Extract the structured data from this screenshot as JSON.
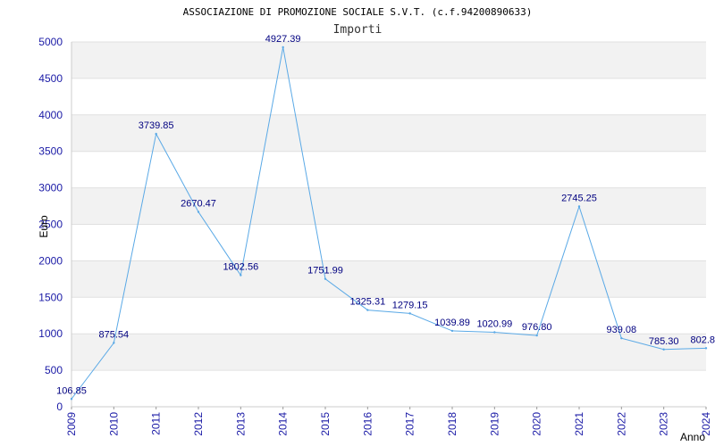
{
  "chart_data": {
    "type": "line",
    "title": "ASSOCIAZIONE DI PROMOZIONE SOCIALE S.V.T. (c.f.94200890633)",
    "subtitle": "Importi",
    "xlabel": "Anno",
    "ylabel": "Euro",
    "x": [
      "2009",
      "2010",
      "2011",
      "2012",
      "2013",
      "2014",
      "2015",
      "2016",
      "2017",
      "2018",
      "2019",
      "2020",
      "2021",
      "2022",
      "2023",
      "2024"
    ],
    "values": [
      106.85,
      875.54,
      3739.85,
      2670.47,
      1802.56,
      4927.39,
      1751.99,
      1325.31,
      1279.15,
      1039.89,
      1020.99,
      976.8,
      2745.25,
      939.08,
      785.3,
      802.8
    ],
    "value_labels": [
      "106.85",
      "875.54",
      "3739.85",
      "2670.47",
      "1802.56",
      "4927.39",
      "1751.99",
      "1325.31",
      "1279.15",
      "1039.89",
      "1020.99",
      "976.80",
      "2745.25",
      "939.08",
      "785.30",
      "802.8"
    ],
    "ylim": [
      0,
      5000
    ],
    "yticks": [
      0,
      500,
      1000,
      1500,
      2000,
      2500,
      3000,
      3500,
      4000,
      4500,
      5000
    ],
    "grid": true,
    "line_color": "#5aa9e6",
    "band_color": "#f2f2f2",
    "tick_color": "#1a1aa6",
    "label_color": "#000080"
  }
}
